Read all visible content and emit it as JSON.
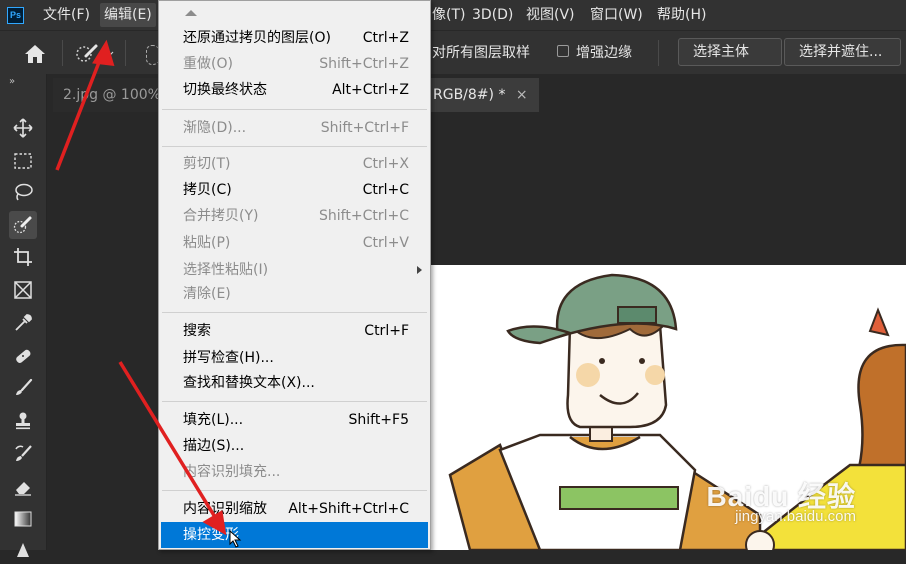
{
  "menubar": {
    "logo": "Ps",
    "items": [
      {
        "label": "文件(F)"
      },
      {
        "label": "编辑(E)"
      },
      {
        "label": "像(T)"
      },
      {
        "label": "3D(D)"
      },
      {
        "label": "视图(V)"
      },
      {
        "label": "窗口(W)"
      },
      {
        "label": "帮助(H)"
      }
    ]
  },
  "options_bar": {
    "sample_all_layers": "对所有图层取样",
    "enhance_edge": "增强边缘",
    "select_subject": "选择主体",
    "select_and_mask": "选择并遮住..."
  },
  "tabs": [
    {
      "label": "2.jpg @ 100%("
    },
    {
      "label": "RGB/8#) *",
      "close": "×"
    }
  ],
  "toolbar": {
    "collapse": "»",
    "tools": [
      "move-tool-icon",
      "marquee-tool-icon",
      "lasso-tool-icon",
      "quick-selection-tool-icon",
      "crop-tool-icon",
      "frame-tool-icon",
      "eyedropper-tool-icon",
      "healing-brush-icon",
      "brush-tool-icon",
      "clone-stamp-icon",
      "history-brush-icon",
      "eraser-tool-icon",
      "gradient-tool-icon",
      "blur-tool-icon"
    ]
  },
  "edit_menu": {
    "items": [
      {
        "label": "还原通过拷贝的图层(O)",
        "shortcut": "Ctrl+Z",
        "disabled": false
      },
      {
        "label": "重做(O)",
        "shortcut": "Shift+Ctrl+Z",
        "disabled": true
      },
      {
        "label": "切换最终状态",
        "shortcut": "Alt+Ctrl+Z",
        "disabled": false
      },
      {
        "label": "渐隐(D)...",
        "shortcut": "Shift+Ctrl+F",
        "disabled": true
      },
      {
        "label": "剪切(T)",
        "shortcut": "Ctrl+X",
        "disabled": true
      },
      {
        "label": "拷贝(C)",
        "shortcut": "Ctrl+C",
        "disabled": false
      },
      {
        "label": "合并拷贝(Y)",
        "shortcut": "Shift+Ctrl+C",
        "disabled": true
      },
      {
        "label": "粘贴(P)",
        "shortcut": "Ctrl+V",
        "disabled": true
      },
      {
        "label": "选择性粘贴(I)",
        "shortcut": "",
        "disabled": true
      },
      {
        "label": "清除(E)",
        "shortcut": "",
        "disabled": true
      },
      {
        "label": "搜索",
        "shortcut": "Ctrl+F",
        "disabled": false
      },
      {
        "label": "拼写检查(H)...",
        "shortcut": "",
        "disabled": false
      },
      {
        "label": "查找和替换文本(X)...",
        "shortcut": "",
        "disabled": false
      },
      {
        "label": "填充(L)...",
        "shortcut": "Shift+F5",
        "disabled": false
      },
      {
        "label": "描边(S)...",
        "shortcut": "",
        "disabled": false
      },
      {
        "label": "内容识别填充...",
        "shortcut": "",
        "disabled": true
      },
      {
        "label": "内容识别缩放",
        "shortcut": "Alt+Shift+Ctrl+C",
        "disabled": false
      },
      {
        "label": "操控变形",
        "shortcut": "",
        "disabled": false,
        "selected": true
      }
    ]
  },
  "watermark": {
    "brand": "Baidu 经验",
    "url": "jingyan.baidu.com"
  },
  "colors": {
    "accent": "#0078d7",
    "arrow": "#e02020"
  }
}
